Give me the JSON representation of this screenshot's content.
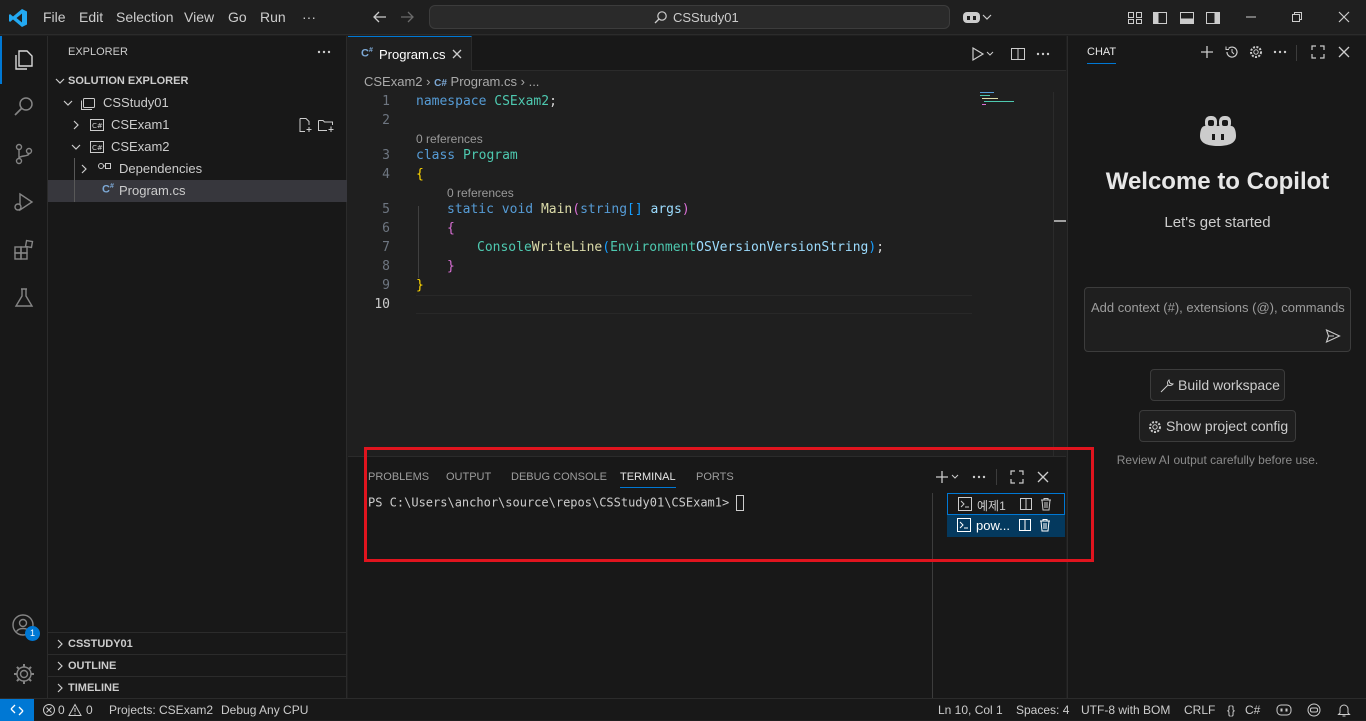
{
  "menu": {
    "file": "File",
    "edit": "Edit",
    "selection": "Selection",
    "view": "View",
    "go": "Go",
    "run": "Run",
    "more": "···"
  },
  "command_center": {
    "text": "CSStudy01"
  },
  "sidebar": {
    "title": "EXPLORER",
    "section": "SOLUTION EXPLORER",
    "tree": [
      {
        "label": "CSStudy01"
      },
      {
        "label": "CSExam1"
      },
      {
        "label": "CSExam2"
      },
      {
        "label": "Dependencies"
      },
      {
        "label": "Program.cs"
      }
    ],
    "bottom_sections": [
      "CSSTUDY01",
      "OUTLINE",
      "TIMELINE"
    ]
  },
  "accounts_badge": "1",
  "editor": {
    "tab": "Program.cs",
    "breadcrumb": {
      "part1": "CSExam2",
      "part2": "Program.cs",
      "part3": "..."
    },
    "codelens": "0 references",
    "line_numbers": [
      "1",
      "2",
      "3",
      "4",
      "5",
      "6",
      "7",
      "8",
      "9",
      "10"
    ],
    "tokens": {
      "namespace": "namespace",
      "csexam2": "CSExam2",
      ";": ";",
      "class": "class",
      "program": "Program",
      "lbrace": "{",
      "rbrace": "}",
      "static": "static",
      "void": "void",
      "main": "Main",
      "lparen": "(",
      "string": "string",
      "brackets": "[]",
      "args": "args",
      "rparen": ")",
      "console": "Console",
      ".": ".",
      "writeline": "WriteLine",
      "environment": "Environment",
      "osversion": "OSVersion",
      "versionstring": "VersionString",
      "close": ");"
    }
  },
  "panel": {
    "tabs": [
      "PROBLEMS",
      "OUTPUT",
      "DEBUG CONSOLE",
      "TERMINAL",
      "PORTS"
    ],
    "active_tab": "TERMINAL",
    "prompt": "PS C:\\Users\\anchor\\source\\repos\\CSStudy01\\CSExam1>",
    "terminals": [
      {
        "label": "예제1"
      },
      {
        "label": "pow..."
      }
    ]
  },
  "chat": {
    "title": "CHAT",
    "welcome": "Welcome to Copilot",
    "subtitle": "Let's get started",
    "input_placeholder": "Add context (#), extensions (@), commands",
    "build_button": "Build workspace",
    "config_button": "Show project config",
    "disclaimer": "Review AI output carefully before use."
  },
  "status": {
    "errors": "0",
    "warnings": "0",
    "projects": "Projects: CSExam2",
    "debug": "Debug Any CPU",
    "position": "Ln 10, Col 1",
    "spaces": "Spaces: 4",
    "encoding": "UTF-8 with BOM",
    "eol": "CRLF",
    "braces": "{}",
    "language": "C#"
  },
  "colors": {
    "accent": "#0078d4",
    "highlight_box": "#e0141e",
    "background": "#1f1f1f"
  }
}
